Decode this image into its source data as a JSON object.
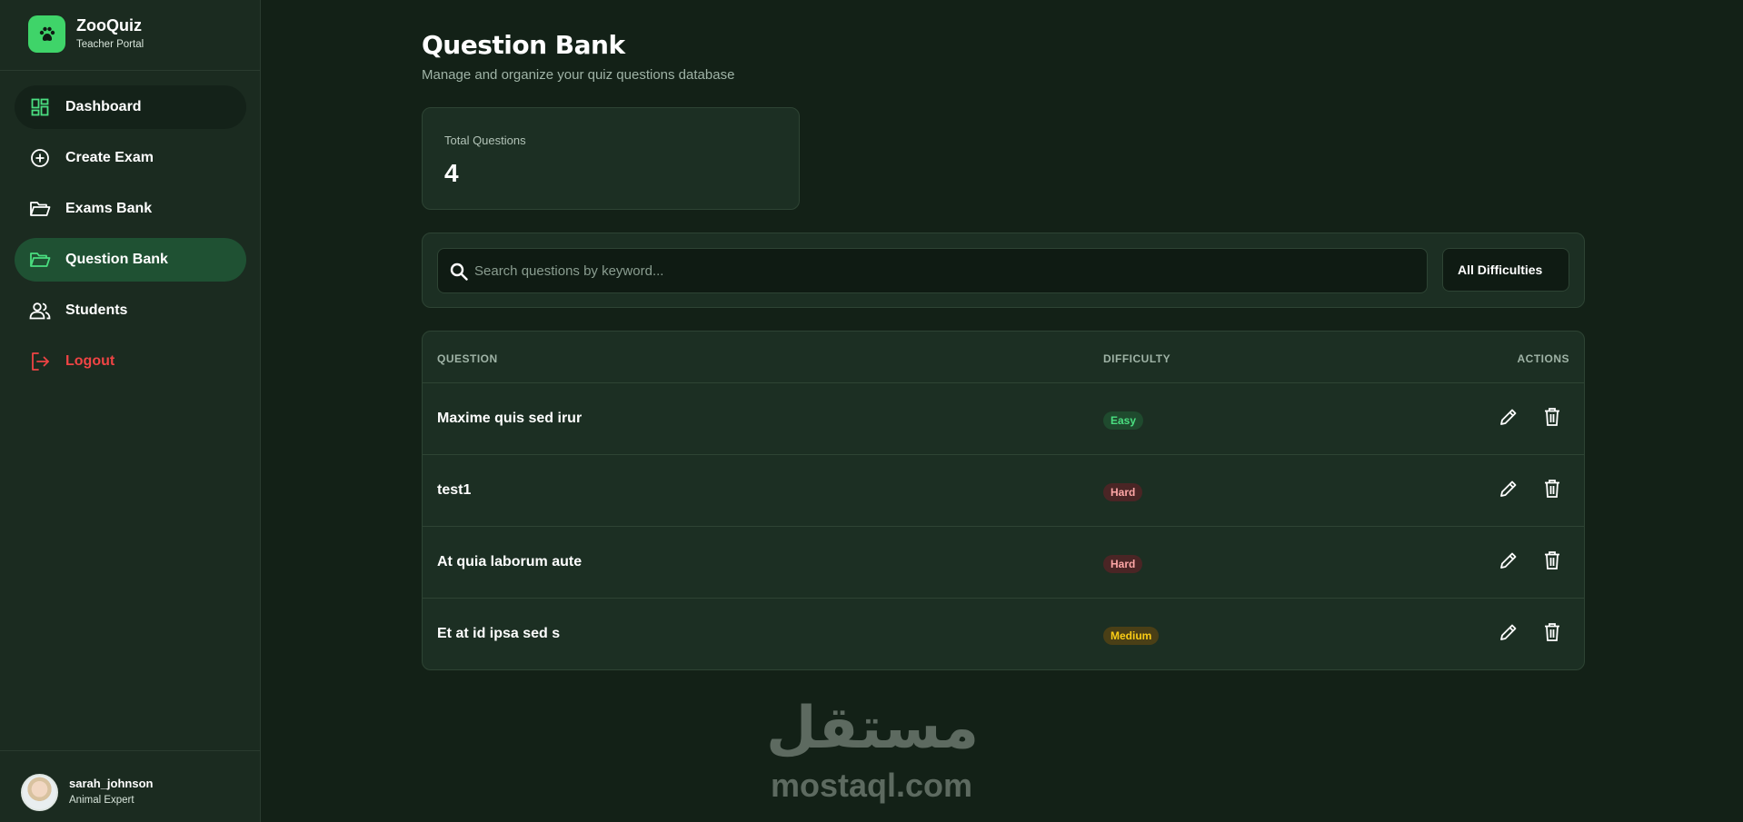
{
  "brand": {
    "name": "ZooQuiz",
    "subtitle": "Teacher Portal",
    "icon": "paw-icon",
    "color": "#3fd469"
  },
  "sidebar": {
    "items": [
      {
        "label": "Dashboard",
        "icon": "dashboard-grid-icon"
      },
      {
        "label": "Create Exam",
        "icon": "plus-circle-icon"
      },
      {
        "label": "Exams Bank",
        "icon": "folder-open-icon"
      },
      {
        "label": "Question Bank",
        "icon": "folder-open-icon",
        "active": true
      },
      {
        "label": "Students",
        "icon": "users-icon"
      },
      {
        "label": "Logout",
        "icon": "logout-icon",
        "color": "#ef4444"
      }
    ]
  },
  "user": {
    "name": "sarah_johnson",
    "role": "Animal Expert"
  },
  "header": {
    "title": "Question Bank",
    "subtitle": "Manage and organize your quiz questions database"
  },
  "stats": {
    "label": "Total Questions",
    "value": "4"
  },
  "filters": {
    "search_placeholder": "Search questions by keyword...",
    "search_value": "",
    "difficulty": "All Difficulties"
  },
  "table": {
    "headers": {
      "question": "QUESTION",
      "difficulty": "DIFFICULTY",
      "actions": "ACTIONS"
    },
    "rows": [
      {
        "question": "Maxime quis sed irur",
        "difficulty": "Easy"
      },
      {
        "question": "test1",
        "difficulty": "Hard"
      },
      {
        "question": "At quia laborum aute",
        "difficulty": "Hard"
      },
      {
        "question": "Et at id ipsa sed s",
        "difficulty": "Medium"
      }
    ]
  },
  "watermark": {
    "arabic": "مستقل",
    "latin": "mostaql.com"
  }
}
